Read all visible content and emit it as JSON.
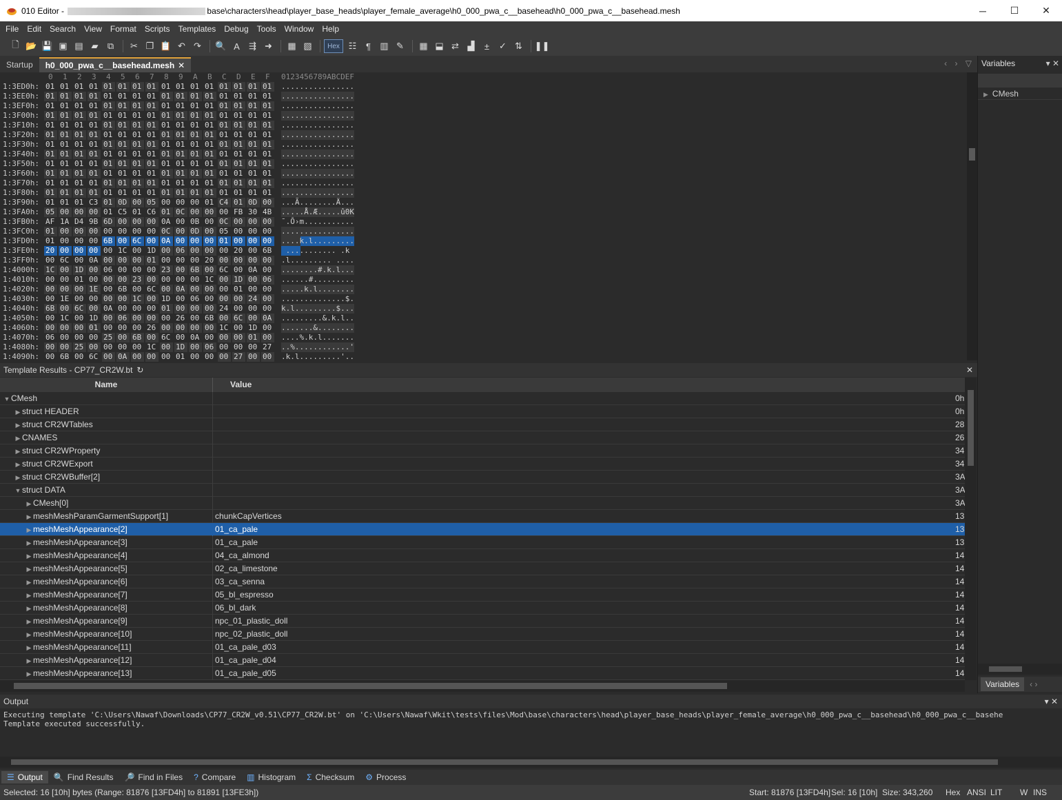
{
  "window": {
    "app_name": "010 Editor -",
    "title_path": "base\\characters\\head\\player_base_heads\\player_female_average\\h0_000_pwa_c__basehead\\h0_000_pwa_c__basehead.mesh",
    "minimize": "─",
    "maximize": "☐",
    "close": "✕"
  },
  "menu": [
    "File",
    "Edit",
    "Search",
    "View",
    "Format",
    "Scripts",
    "Templates",
    "Debug",
    "Tools",
    "Window",
    "Help"
  ],
  "toolbar": {
    "hex_label": "Hex",
    "icons": [
      "new-file-icon",
      "open-file-icon",
      "save-icon",
      "save-as-icon",
      "save-all-icon",
      "open-folder-icon",
      "workspace-icon",
      "cut-icon",
      "copy-icon",
      "paste-icon",
      "undo-icon",
      "redo-icon",
      "find-icon",
      "replace-icon",
      "find-in-files-icon",
      "goto-icon",
      "template-icon",
      "script-icon",
      "hex-toggle-icon",
      "columns-icon",
      "paragraph-icon",
      "column-mode-icon",
      "highlight-icon",
      "calculator-icon",
      "compare-icon",
      "swap-icon",
      "histogram-icon",
      "operations-icon",
      "checksum-icon",
      "conversion-icon",
      "pause-icon"
    ]
  },
  "tabs": [
    {
      "label": "Startup",
      "active": false
    },
    {
      "label": "h0_000_pwa_c__basehead.mesh",
      "active": true,
      "close": "✕"
    }
  ],
  "tab_nav": "‹ › ▽",
  "hex": {
    "header_cols": [
      "0",
      "1",
      "2",
      "3",
      "4",
      "5",
      "6",
      "7",
      "8",
      "9",
      "A",
      "B",
      "C",
      "D",
      "E",
      "F"
    ],
    "ascii_header": "0123456789ABCDEF",
    "rows": [
      {
        "addr": "1:3ED0h:",
        "bytes": "01 01 01 01 01 01 01 01 01 01 01 01 01 01 01 01",
        "ascii": "................"
      },
      {
        "addr": "1:3EE0h:",
        "bytes": "01 01 01 01 01 01 01 01 01 01 01 01 01 01 01 01",
        "ascii": "................"
      },
      {
        "addr": "1:3EF0h:",
        "bytes": "01 01 01 01 01 01 01 01 01 01 01 01 01 01 01 01",
        "ascii": "................"
      },
      {
        "addr": "1:3F00h:",
        "bytes": "01 01 01 01 01 01 01 01 01 01 01 01 01 01 01 01",
        "ascii": "................"
      },
      {
        "addr": "1:3F10h:",
        "bytes": "01 01 01 01 01 01 01 01 01 01 01 01 01 01 01 01",
        "ascii": "................"
      },
      {
        "addr": "1:3F20h:",
        "bytes": "01 01 01 01 01 01 01 01 01 01 01 01 01 01 01 01",
        "ascii": "................"
      },
      {
        "addr": "1:3F30h:",
        "bytes": "01 01 01 01 01 01 01 01 01 01 01 01 01 01 01 01",
        "ascii": "................"
      },
      {
        "addr": "1:3F40h:",
        "bytes": "01 01 01 01 01 01 01 01 01 01 01 01 01 01 01 01",
        "ascii": "................"
      },
      {
        "addr": "1:3F50h:",
        "bytes": "01 01 01 01 01 01 01 01 01 01 01 01 01 01 01 01",
        "ascii": "................"
      },
      {
        "addr": "1:3F60h:",
        "bytes": "01 01 01 01 01 01 01 01 01 01 01 01 01 01 01 01",
        "ascii": "................"
      },
      {
        "addr": "1:3F70h:",
        "bytes": "01 01 01 01 01 01 01 01 01 01 01 01 01 01 01 01",
        "ascii": "................"
      },
      {
        "addr": "1:3F80h:",
        "bytes": "01 01 01 01 01 01 01 01 01 01 01 01 01 01 01 01",
        "ascii": "................"
      },
      {
        "addr": "1:3F90h:",
        "bytes": "01 01 01 C3 01 0D 00 05 00 00 00 01 C4 01 0D 00",
        "ascii": "...Ã........Ä..."
      },
      {
        "addr": "1:3FA0h:",
        "bytes": "05 00 00 00 01 C5 01 C6 01 0C 00 00 00 FB 30 4B",
        "ascii": ".....Å.Æ.....û0K"
      },
      {
        "addr": "1:3FB0h:",
        "bytes": "AF 1A D4 9B 6D 00 00 00 0A 00 0B 00 0C 00 00 00",
        "ascii": "¯.Ô›m..........."
      },
      {
        "addr": "1:3FC0h:",
        "bytes": "01 00 00 00 00 00 00 00 0C 00 0D 00 05 00 00 00",
        "ascii": "................"
      },
      {
        "addr": "1:3FD0h:",
        "bytes": "01 00 00 00 6B 00 6C 00 0A 00 00 00 01 00 00 00",
        "ascii": "....k.l........."
      },
      {
        "addr": "1:3FE0h:",
        "bytes": "20 00 00 00 00 1C 00 1D 00 06 00 00 00 20 00 6B",
        "ascii": " ........... .k"
      },
      {
        "addr": "1:3FF0h:",
        "bytes": "00 6C 00 0A 00 00 00 01 00 00 00 20 00 00 00 00",
        "ascii": ".l......... ...."
      },
      {
        "addr": "1:4000h:",
        "bytes": "1C 00 1D 00 06 00 00 00 23 00 6B 00 6C 00 0A 00",
        "ascii": "........#.k.l..."
      },
      {
        "addr": "1:4010h:",
        "bytes": "00 00 01 00 00 00 23 00 00 00 00 1C 00 1D 00 06",
        "ascii": "......#........."
      },
      {
        "addr": "1:4020h:",
        "bytes": "00 00 00 1E 00 6B 00 6C 00 0A 00 00 00 01 00 00",
        "ascii": ".....k.l........"
      },
      {
        "addr": "1:4030h:",
        "bytes": "00 1E 00 00 00 00 1C 00 1D 00 06 00 00 00 24 00",
        "ascii": "..............$."
      },
      {
        "addr": "1:4040h:",
        "bytes": "6B 00 6C 00 0A 00 00 00 01 00 00 00 24 00 00 00",
        "ascii": "k.l.........$..."
      },
      {
        "addr": "1:4050h:",
        "bytes": "00 1C 00 1D 00 06 00 00 00 26 00 6B 00 6C 00 0A",
        "ascii": ".........&.k.l.."
      },
      {
        "addr": "1:4060h:",
        "bytes": "00 00 00 01 00 00 00 26 00 00 00 00 1C 00 1D 00",
        "ascii": ".......&........"
      },
      {
        "addr": "1:4070h:",
        "bytes": "06 00 00 00 25 00 6B 00 6C 00 0A 00 00 00 01 00",
        "ascii": "....%.k.l......."
      },
      {
        "addr": "1:4080h:",
        "bytes": "00 00 25 00 00 00 00 1C 00 1D 00 06 00 00 00 27",
        "ascii": "..%............'"
      },
      {
        "addr": "1:4090h:",
        "bytes": "00 6B 00 6C 00 0A 00 00 00 01 00 00 00 27 00 00",
        "ascii": ".k.l.........'.."
      }
    ]
  },
  "template": {
    "title": "Template Results - CP77_CR2W.bt",
    "refresh_icon": "↻",
    "close": "✕",
    "col_name": "Name",
    "col_value": "Value",
    "rows": [
      {
        "name": "CMesh",
        "value": "",
        "start": "0h",
        "level": 0,
        "arrow": "expanded"
      },
      {
        "name": "struct HEADER",
        "value": "",
        "start": "0h",
        "level": 1,
        "arrow": "collapsed"
      },
      {
        "name": "struct CR2WTables",
        "value": "",
        "start": "28",
        "level": 1,
        "arrow": "collapsed"
      },
      {
        "name": "CNAMES",
        "value": "",
        "start": "26",
        "level": 1,
        "arrow": "collapsed"
      },
      {
        "name": "struct CR2WProperty",
        "value": "",
        "start": "34",
        "level": 1,
        "arrow": "collapsed"
      },
      {
        "name": "struct CR2WExport",
        "value": "",
        "start": "34",
        "level": 1,
        "arrow": "collapsed"
      },
      {
        "name": "struct CR2WBuffer[2]",
        "value": "",
        "start": "3A",
        "level": 1,
        "arrow": "collapsed"
      },
      {
        "name": "struct DATA",
        "value": "",
        "start": "3A",
        "level": 1,
        "arrow": "expanded"
      },
      {
        "name": "CMesh[0]",
        "value": "",
        "start": "3A",
        "level": 2,
        "arrow": "collapsed"
      },
      {
        "name": "meshMeshParamGarmentSupport[1]",
        "value": "chunkCapVertices",
        "start": "13",
        "level": 2,
        "arrow": "collapsed"
      },
      {
        "name": "meshMeshAppearance[2]",
        "value": "01_ca_pale",
        "start": "13",
        "level": 2,
        "arrow": "collapsed",
        "selected": true
      },
      {
        "name": "meshMeshAppearance[3]",
        "value": "01_ca_pale",
        "start": "13",
        "level": 2,
        "arrow": "collapsed"
      },
      {
        "name": "meshMeshAppearance[4]",
        "value": "04_ca_almond",
        "start": "14",
        "level": 2,
        "arrow": "collapsed"
      },
      {
        "name": "meshMeshAppearance[5]",
        "value": "02_ca_limestone",
        "start": "14",
        "level": 2,
        "arrow": "collapsed"
      },
      {
        "name": "meshMeshAppearance[6]",
        "value": "03_ca_senna",
        "start": "14",
        "level": 2,
        "arrow": "collapsed"
      },
      {
        "name": "meshMeshAppearance[7]",
        "value": "05_bl_espresso",
        "start": "14",
        "level": 2,
        "arrow": "collapsed"
      },
      {
        "name": "meshMeshAppearance[8]",
        "value": "06_bl_dark",
        "start": "14",
        "level": 2,
        "arrow": "collapsed"
      },
      {
        "name": "meshMeshAppearance[9]",
        "value": "npc_01_plastic_doll",
        "start": "14",
        "level": 2,
        "arrow": "collapsed"
      },
      {
        "name": "meshMeshAppearance[10]",
        "value": "npc_02_plastic_doll",
        "start": "14",
        "level": 2,
        "arrow": "collapsed"
      },
      {
        "name": "meshMeshAppearance[11]",
        "value": "01_ca_pale_d03",
        "start": "14",
        "level": 2,
        "arrow": "collapsed"
      },
      {
        "name": "meshMeshAppearance[12]",
        "value": "01_ca_pale_d04",
        "start": "14",
        "level": 2,
        "arrow": "collapsed"
      },
      {
        "name": "meshMeshAppearance[13]",
        "value": "01_ca_pale_d05",
        "start": "14",
        "level": 2,
        "arrow": "collapsed"
      }
    ]
  },
  "variables": {
    "title": "Variables",
    "pin": "▾",
    "close": "✕",
    "items": [
      "CMesh"
    ],
    "tab_label": "Variables",
    "tab_nav": "‹ ›"
  },
  "output": {
    "title": "Output",
    "pin": "▾",
    "close": "✕",
    "lines": [
      "Executing template 'C:\\Users\\Nawaf\\Downloads\\CP77_CR2W_v0.51\\CP77_CR2W.bt' on 'C:\\Users\\Nawaf\\Wkit\\tests\\files\\Mod\\base\\characters\\head\\player_base_heads\\player_female_average\\h0_000_pwa_c__basehead\\h0_000_pwa_c__basehe",
      "Template executed successfully."
    ]
  },
  "bottom_tabs": [
    {
      "label": "Output",
      "icon": "output-icon",
      "glyph": "☰",
      "active": true
    },
    {
      "label": "Find Results",
      "icon": "find-results-icon",
      "glyph": "🔍",
      "active": false
    },
    {
      "label": "Find in Files",
      "icon": "find-in-files-icon",
      "glyph": "🔎",
      "active": false
    },
    {
      "label": "Compare",
      "icon": "compare-icon",
      "glyph": "?",
      "active": false
    },
    {
      "label": "Histogram",
      "icon": "histogram-icon",
      "glyph": "▥",
      "active": false
    },
    {
      "label": "Checksum",
      "icon": "checksum-icon",
      "glyph": "Σ",
      "active": false
    },
    {
      "label": "Process",
      "icon": "process-icon",
      "glyph": "⚙",
      "active": false
    }
  ],
  "status": {
    "selected": "Selected: 16 [10h] bytes (Range: 81876 [13FD4h] to 81891 [13FE3h])",
    "start": "Start: 81876 [13FD4h]",
    "sel": "Sel: 16 [10h]",
    "size": "Size: 343,260",
    "mode": "Hex",
    "encoding": "ANSI",
    "endian": "LIT",
    "write": "W",
    "insert": "INS"
  }
}
